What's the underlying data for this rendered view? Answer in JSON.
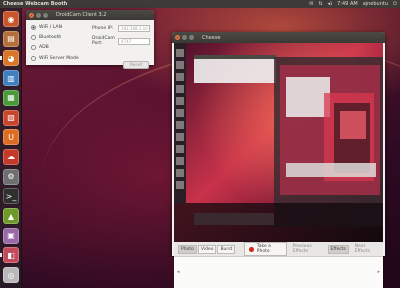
{
  "top_panel": {
    "title": "Cheese Webcam Booth",
    "time": "7:49 AM",
    "user": "ajnebuntu",
    "tray_icons": [
      "mail-icon",
      "network-icon",
      "volume-icon",
      "power-icon"
    ]
  },
  "launcher": {
    "items": [
      {
        "name": "dash",
        "glyph": "◉",
        "color": "#c9552c"
      },
      {
        "name": "files",
        "glyph": "▤",
        "color": "#b46f3a"
      },
      {
        "name": "firefox",
        "glyph": "◕",
        "color": "#d8772a"
      },
      {
        "name": "libreoffice-writer",
        "glyph": "▥",
        "color": "#3f7fc0"
      },
      {
        "name": "libreoffice-calc",
        "glyph": "▦",
        "color": "#4a9a3a"
      },
      {
        "name": "libreoffice-impress",
        "glyph": "▧",
        "color": "#c7462c"
      },
      {
        "name": "ubuntu-software",
        "glyph": "U",
        "color": "#dd6c24"
      },
      {
        "name": "ubuntu-one",
        "glyph": "☁",
        "color": "#c43a2a"
      },
      {
        "name": "system-settings",
        "glyph": "⚙",
        "color": "#6e6e6e"
      },
      {
        "name": "terminal",
        "glyph": ">_",
        "color": "#2f2f2f"
      },
      {
        "name": "android",
        "glyph": "▲",
        "color": "#6e9a2a"
      },
      {
        "name": "cheese",
        "glyph": "▣",
        "color": "#9a6aa8"
      },
      {
        "name": "droidcam",
        "glyph": "◧",
        "color": "#c34a5a"
      },
      {
        "name": "dvd",
        "glyph": "◎",
        "color": "#b8b8b8"
      }
    ]
  },
  "droidcam": {
    "title": "DroidCam Client 3.2",
    "options": [
      "WiFi / LAN",
      "Bluetooth",
      "ADB",
      "WiFi Server Mode"
    ],
    "selected": 0,
    "phone_ip_label": "Phone IP:",
    "phone_ip_value": "192.168.1.10",
    "port_label": "DroidCam Port:",
    "port_value": "4747",
    "reset_label": "Reset"
  },
  "cheese": {
    "title": "Cheese",
    "modes": [
      "Photo",
      "Video",
      "Burst"
    ],
    "active_mode": 0,
    "take_photo_label": "Take a Photo",
    "prev_effects_label": "Previous Effects",
    "effects_label": "Effects",
    "next_effects_label": "Next Effects"
  },
  "colors": {
    "panel": "#3c3b37",
    "accent_orange": "#f07746",
    "record_red": "#d8261f"
  }
}
